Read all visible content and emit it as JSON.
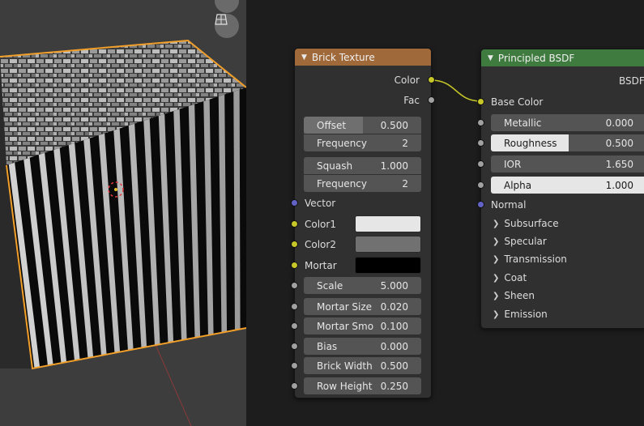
{
  "colors": {
    "brick_header": "#a0693a",
    "bsdf_header": "#3f7a3f",
    "selection_orange": "#f29f2a",
    "socket_color": "#c7c729",
    "socket_float": "#a1a1a1",
    "socket_vector": "#6363c7"
  },
  "viewport": {
    "icons": [
      "camera-icon",
      "grid-icon"
    ]
  },
  "brick_node": {
    "title": "Brick Texture",
    "outputs": [
      "Color",
      "Fac"
    ],
    "offset_label": "Offset",
    "offset_value": "0.500",
    "frequency1_label": "Frequency",
    "frequency1_value": "2",
    "squash_label": "Squash",
    "squash_value": "1.000",
    "frequency2_label": "Frequency",
    "frequency2_value": "2",
    "vector_label": "Vector",
    "color1_label": "Color1",
    "color1_swatch": "#e6e6e6",
    "color2_label": "Color2",
    "color2_swatch": "#717171",
    "mortar_label": "Mortar",
    "mortar_swatch": "#000000",
    "scale_label": "Scale",
    "scale_value": "5.000",
    "mortar_size_label": "Mortar Size",
    "mortar_size_value": "0.020",
    "mortar_smooth_label": "Mortar Smo",
    "mortar_smooth_value": "0.100",
    "bias_label": "Bias",
    "bias_value": "0.000",
    "brick_width_label": "Brick Width",
    "brick_width_value": "0.500",
    "row_height_label": "Row Height",
    "row_height_value": "0.250"
  },
  "bsdf_node": {
    "title": "Principled BSDF",
    "output_label": "BSDF",
    "base_color_label": "Base Color",
    "metallic_label": "Metallic",
    "metallic_value": "0.000",
    "roughness_label": "Roughness",
    "roughness_value": "0.500",
    "ior_label": "IOR",
    "ior_value": "1.650",
    "alpha_label": "Alpha",
    "alpha_value": "1.000",
    "normal_label": "Normal",
    "panels": [
      "Subsurface",
      "Specular",
      "Transmission",
      "Coat",
      "Sheen",
      "Emission"
    ]
  }
}
